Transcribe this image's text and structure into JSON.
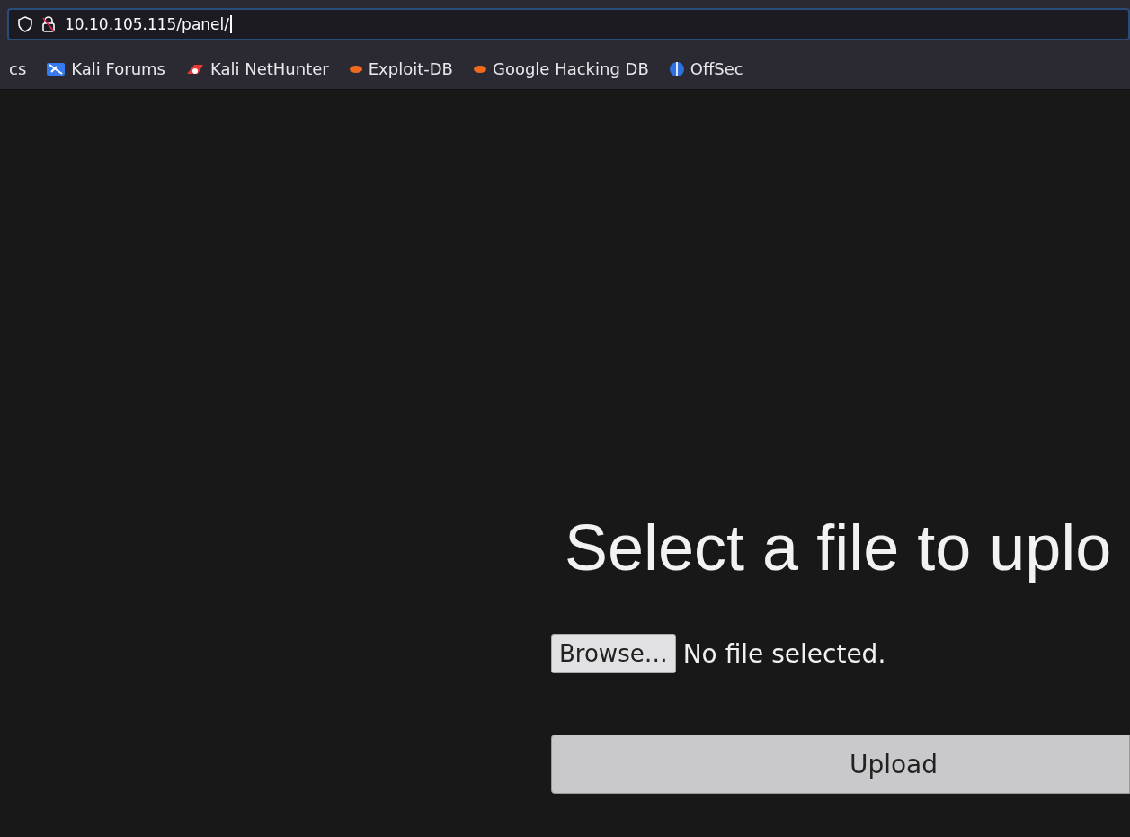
{
  "address_bar": {
    "url": "10.10.105.115/panel/"
  },
  "bookmarks": [
    {
      "label": "cs",
      "kind": "text"
    },
    {
      "label": "Kali Forums",
      "kind": "forums"
    },
    {
      "label": "Kali NetHunter",
      "kind": "nethunter"
    },
    {
      "label": "Exploit-DB",
      "kind": "exploit"
    },
    {
      "label": "Google Hacking DB",
      "kind": "exploit"
    },
    {
      "label": "OffSec",
      "kind": "offsec"
    }
  ],
  "page": {
    "heading": "Select a file to uplo",
    "browse_button": "Browse…",
    "file_status": "No file selected.",
    "upload_button": "Upload"
  }
}
